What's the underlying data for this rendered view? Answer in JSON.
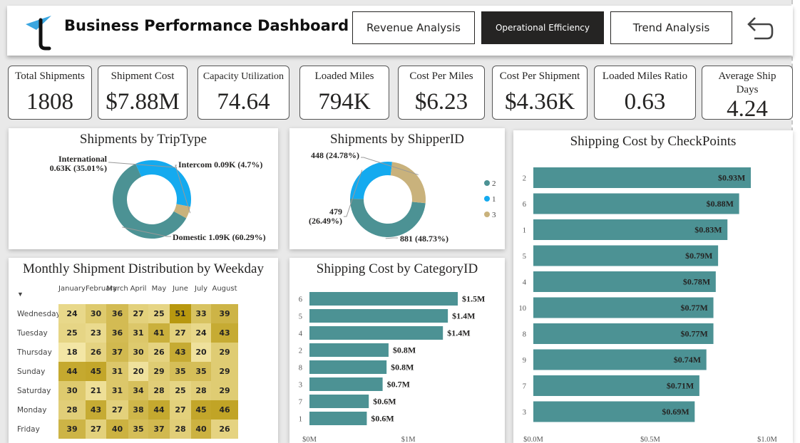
{
  "header": {
    "title": "Business Performance Dashboard",
    "nav": [
      "Revenue Analysis",
      "Operational Efficiency",
      "Trend Analysis"
    ],
    "active_nav": "Operational Efficiency"
  },
  "kpis": [
    {
      "label": "Total Shipments",
      "value": "1808"
    },
    {
      "label": "Shipment Cost",
      "value": "$7.88M"
    },
    {
      "label": "Capacity Utilization",
      "value": "74.64"
    },
    {
      "label": "Loaded Miles",
      "value": "794K"
    },
    {
      "label": "Cost Per Miles",
      "value": "$6.23"
    },
    {
      "label": "Cost Per Shipment",
      "value": "$4.36K"
    },
    {
      "label": "Loaded Miles Ratio",
      "value": "0.63"
    },
    {
      "label": "Average Ship Days",
      "value": "4.24"
    }
  ],
  "colors": {
    "teal": "#4c9294",
    "blue": "#14aaef",
    "tan": "#c9b27c",
    "heat_low": "#f3e6a5",
    "heat_high": "#b8980f"
  },
  "chart_data": [
    {
      "type": "pie",
      "title": "Shipments by TripType",
      "slices": [
        {
          "name": "Domestic",
          "value": 1.09,
          "percent": 60.29,
          "label": "Domestic 1.09K (60.29%)",
          "color": "#4c9294"
        },
        {
          "name": "International",
          "value": 0.63,
          "percent": 35.01,
          "label_lines": [
            "International",
            "0.63K (35.01%)"
          ],
          "color": "#14aaef"
        },
        {
          "name": "Intercom",
          "value": 0.09,
          "percent": 4.7,
          "label": "Intercom 0.09K (4.7%)",
          "color": "#c9b27c"
        }
      ]
    },
    {
      "type": "pie",
      "title": "Shipments by ShipperID",
      "slices": [
        {
          "name": "2",
          "value": 881,
          "percent": 48.73,
          "label": "881 (48.73%)",
          "color": "#4c9294"
        },
        {
          "name": "1",
          "value": 479,
          "percent": 26.49,
          "label_lines": [
            "479",
            "(26.49%)"
          ],
          "color": "#14aaef"
        },
        {
          "name": "3",
          "value": 448,
          "percent": 24.78,
          "label": "448 (24.78%)",
          "color": "#c9b27c"
        }
      ],
      "legend": [
        "2",
        "1",
        "3"
      ]
    },
    {
      "type": "bar",
      "orientation": "horizontal",
      "title": "Shipping Cost by CheckPoints",
      "categories": [
        "2",
        "6",
        "1",
        "5",
        "4",
        "10",
        "8",
        "9",
        "7",
        "3"
      ],
      "values": [
        0.93,
        0.88,
        0.83,
        0.79,
        0.78,
        0.77,
        0.77,
        0.74,
        0.71,
        0.69
      ],
      "labels": [
        "$0.93M",
        "$0.88M",
        "$0.83M",
        "$0.79M",
        "$0.78M",
        "$0.77M",
        "$0.77M",
        "$0.74M",
        "$0.71M",
        "$0.69M"
      ],
      "xlim": [
        0,
        1.0
      ],
      "xticks": [
        "$0.0M",
        "$0.5M",
        "$1.0M"
      ]
    },
    {
      "type": "bar",
      "orientation": "horizontal",
      "title": "Shipping Cost by CategoryID",
      "categories": [
        "6",
        "5",
        "4",
        "2",
        "8",
        "3",
        "7",
        "1"
      ],
      "values": [
        1.5,
        1.4,
        1.35,
        0.8,
        0.78,
        0.74,
        0.6,
        0.58
      ],
      "labels": [
        "$1.5M",
        "$1.4M",
        "$1.4M",
        "$0.8M",
        "$0.8M",
        "$0.7M",
        "$0.6M",
        "$0.6M"
      ],
      "xlim": [
        0,
        1.5
      ],
      "xticks": [
        "$0M",
        "$1M"
      ]
    },
    {
      "type": "heatmap",
      "title": "Monthly Shipment Distribution by Weekday",
      "columns": [
        "January",
        "February",
        "March",
        "April",
        "May",
        "June",
        "July",
        "August"
      ],
      "rows": [
        "Wednesday",
        "Tuesday",
        "Thursday",
        "Sunday",
        "Saturday",
        "Monday",
        "Friday"
      ],
      "values": [
        [
          24,
          30,
          36,
          27,
          25,
          51,
          33,
          39
        ],
        [
          25,
          23,
          36,
          31,
          41,
          27,
          24,
          43
        ],
        [
          18,
          26,
          37,
          30,
          26,
          43,
          20,
          29
        ],
        [
          44,
          45,
          31,
          20,
          29,
          35,
          35,
          29
        ],
        [
          30,
          21,
          31,
          34,
          28,
          25,
          28,
          29
        ],
        [
          28,
          43,
          27,
          38,
          44,
          27,
          45,
          46
        ],
        [
          39,
          27,
          40,
          35,
          37,
          28,
          40,
          26
        ]
      ]
    }
  ]
}
